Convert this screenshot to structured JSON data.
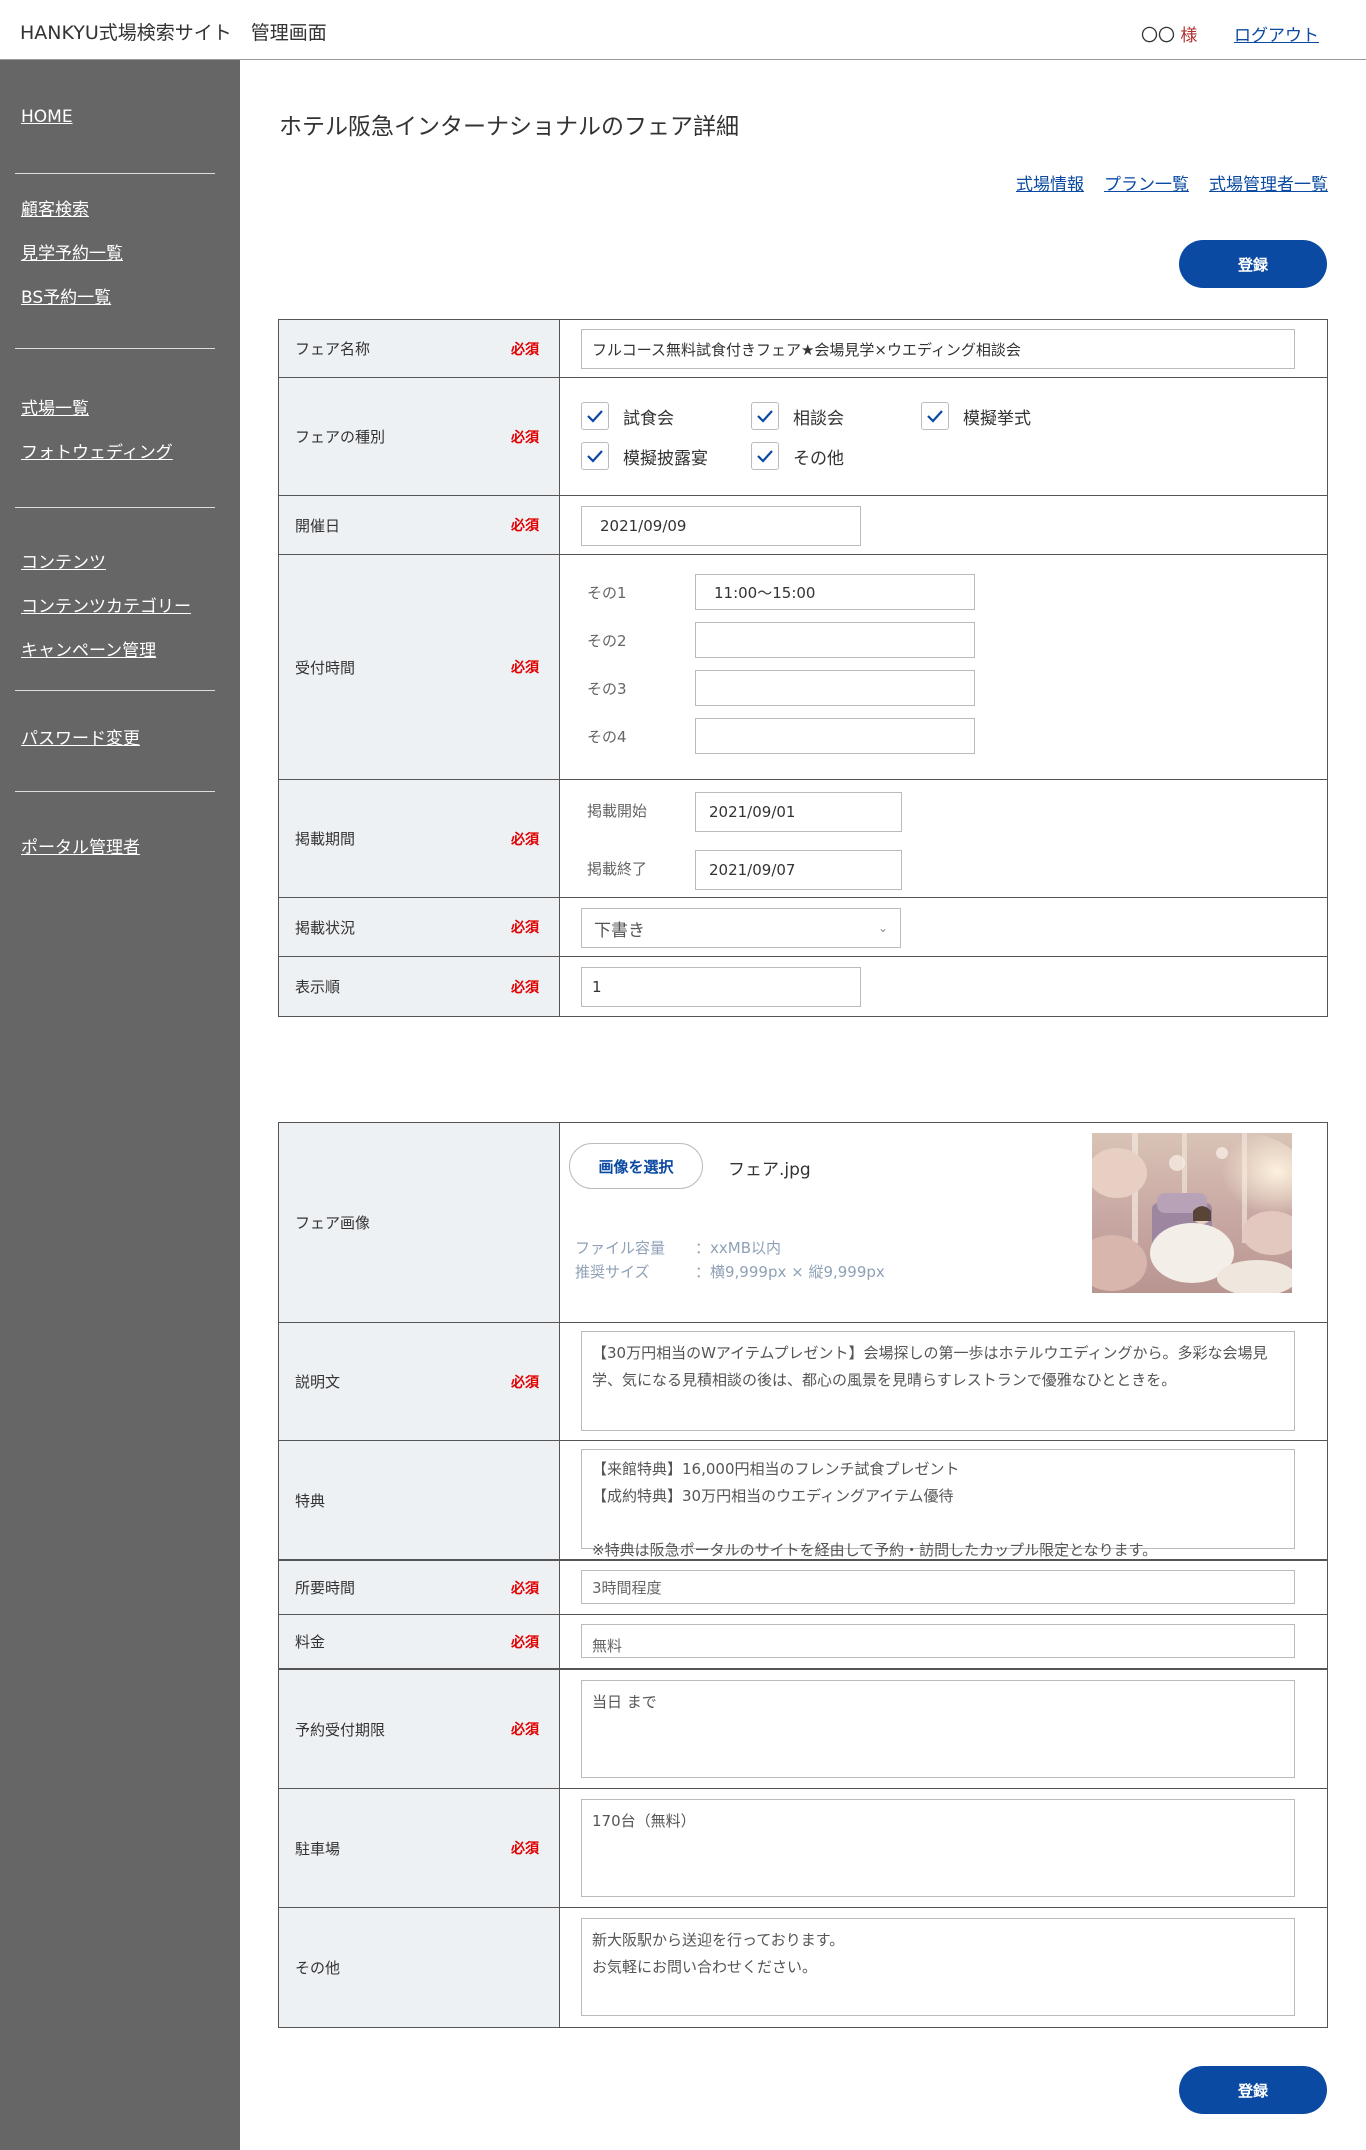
{
  "header": {
    "title": "HANKYU式場検索サイト　管理画面",
    "user": "〇〇",
    "honorific": "様",
    "logout": "ログアウト"
  },
  "sidebar": {
    "home": "HOME",
    "group1": [
      "顧客検索",
      "見学予約一覧",
      "BS予約一覧"
    ],
    "group2": [
      "式場一覧",
      "フォトウェディング"
    ],
    "group3": [
      "コンテンツ",
      "コンテンツカテゴリー",
      "キャンペーン管理"
    ],
    "group4": [
      "パスワード変更"
    ],
    "group5": [
      "ポータル管理者"
    ]
  },
  "page": {
    "title": "ホテル阪急インターナショナルのフェア詳細",
    "links": [
      "式場情報",
      "プラン一覧",
      "式場管理者一覧"
    ],
    "register": "登録"
  },
  "required": "必須",
  "form1": {
    "fair_name": {
      "label": "フェア名称",
      "value": "フルコース無料試食付きフェア★会場見学×ウエディング相談会"
    },
    "fair_type": {
      "label": "フェアの種別",
      "options": [
        {
          "label": "試食会",
          "checked": true
        },
        {
          "label": "相談会",
          "checked": true
        },
        {
          "label": "模擬挙式",
          "checked": true
        },
        {
          "label": "模擬披露宴",
          "checked": true
        },
        {
          "label": "その他",
          "checked": true
        }
      ]
    },
    "date": {
      "label": "開催日",
      "value": "2021/09/09"
    },
    "reception": {
      "label": "受付時間",
      "slots": [
        {
          "label": "その1",
          "value": "11:00〜15:00"
        },
        {
          "label": "その2",
          "value": ""
        },
        {
          "label": "その3",
          "value": ""
        },
        {
          "label": "その4",
          "value": ""
        }
      ]
    },
    "period": {
      "label": "掲載期間",
      "start_label": "掲載開始",
      "start": "2021/09/01",
      "end_label": "掲載終了",
      "end": "2021/09/07"
    },
    "status": {
      "label": "掲載状況",
      "value": "下書き"
    },
    "order": {
      "label": "表示順",
      "value": "1"
    }
  },
  "form2": {
    "image": {
      "label": "フェア画像",
      "button": "画像を選択",
      "filename": "フェア.jpg",
      "size_label": "ファイル容量",
      "size_value": "：xxMB以内",
      "rec_label": "推奨サイズ",
      "rec_value": "：横9,999px × 縦9,999px"
    },
    "description": {
      "label": "説明文",
      "value": "【30万円相当のWアイテムプレゼント】会場探しの第一歩はホテルウエディングから。多彩な会場見学、気になる見積相談の後は、都心の風景を見晴らすレストランで優雅なひとときを。"
    },
    "benefit": {
      "label": "特典",
      "value": "【来館特典】16,000円相当のフレンチ試食プレゼント\n【成約特典】30万円相当のウエディングアイテム優待\n\n※特典は阪急ポータルのサイトを経由して予約・訪問したカップル限定となります。"
    },
    "duration": {
      "label": "所要時間",
      "value": "3時間程度"
    },
    "fee": {
      "label": "料金",
      "value": "無料"
    },
    "deadline": {
      "label": "予約受付期限",
      "value": "当日 まで"
    },
    "parking": {
      "label": "駐車場",
      "value": "170台（無料）"
    },
    "other": {
      "label": "その他",
      "value": "新大阪駅から送迎を行っております。\nお気軽にお問い合わせください。"
    }
  },
  "colors": {
    "primary": "#0b4aa2",
    "sidebar": "#666666",
    "required": "#e00000",
    "label_bg": "#eef1f4"
  }
}
